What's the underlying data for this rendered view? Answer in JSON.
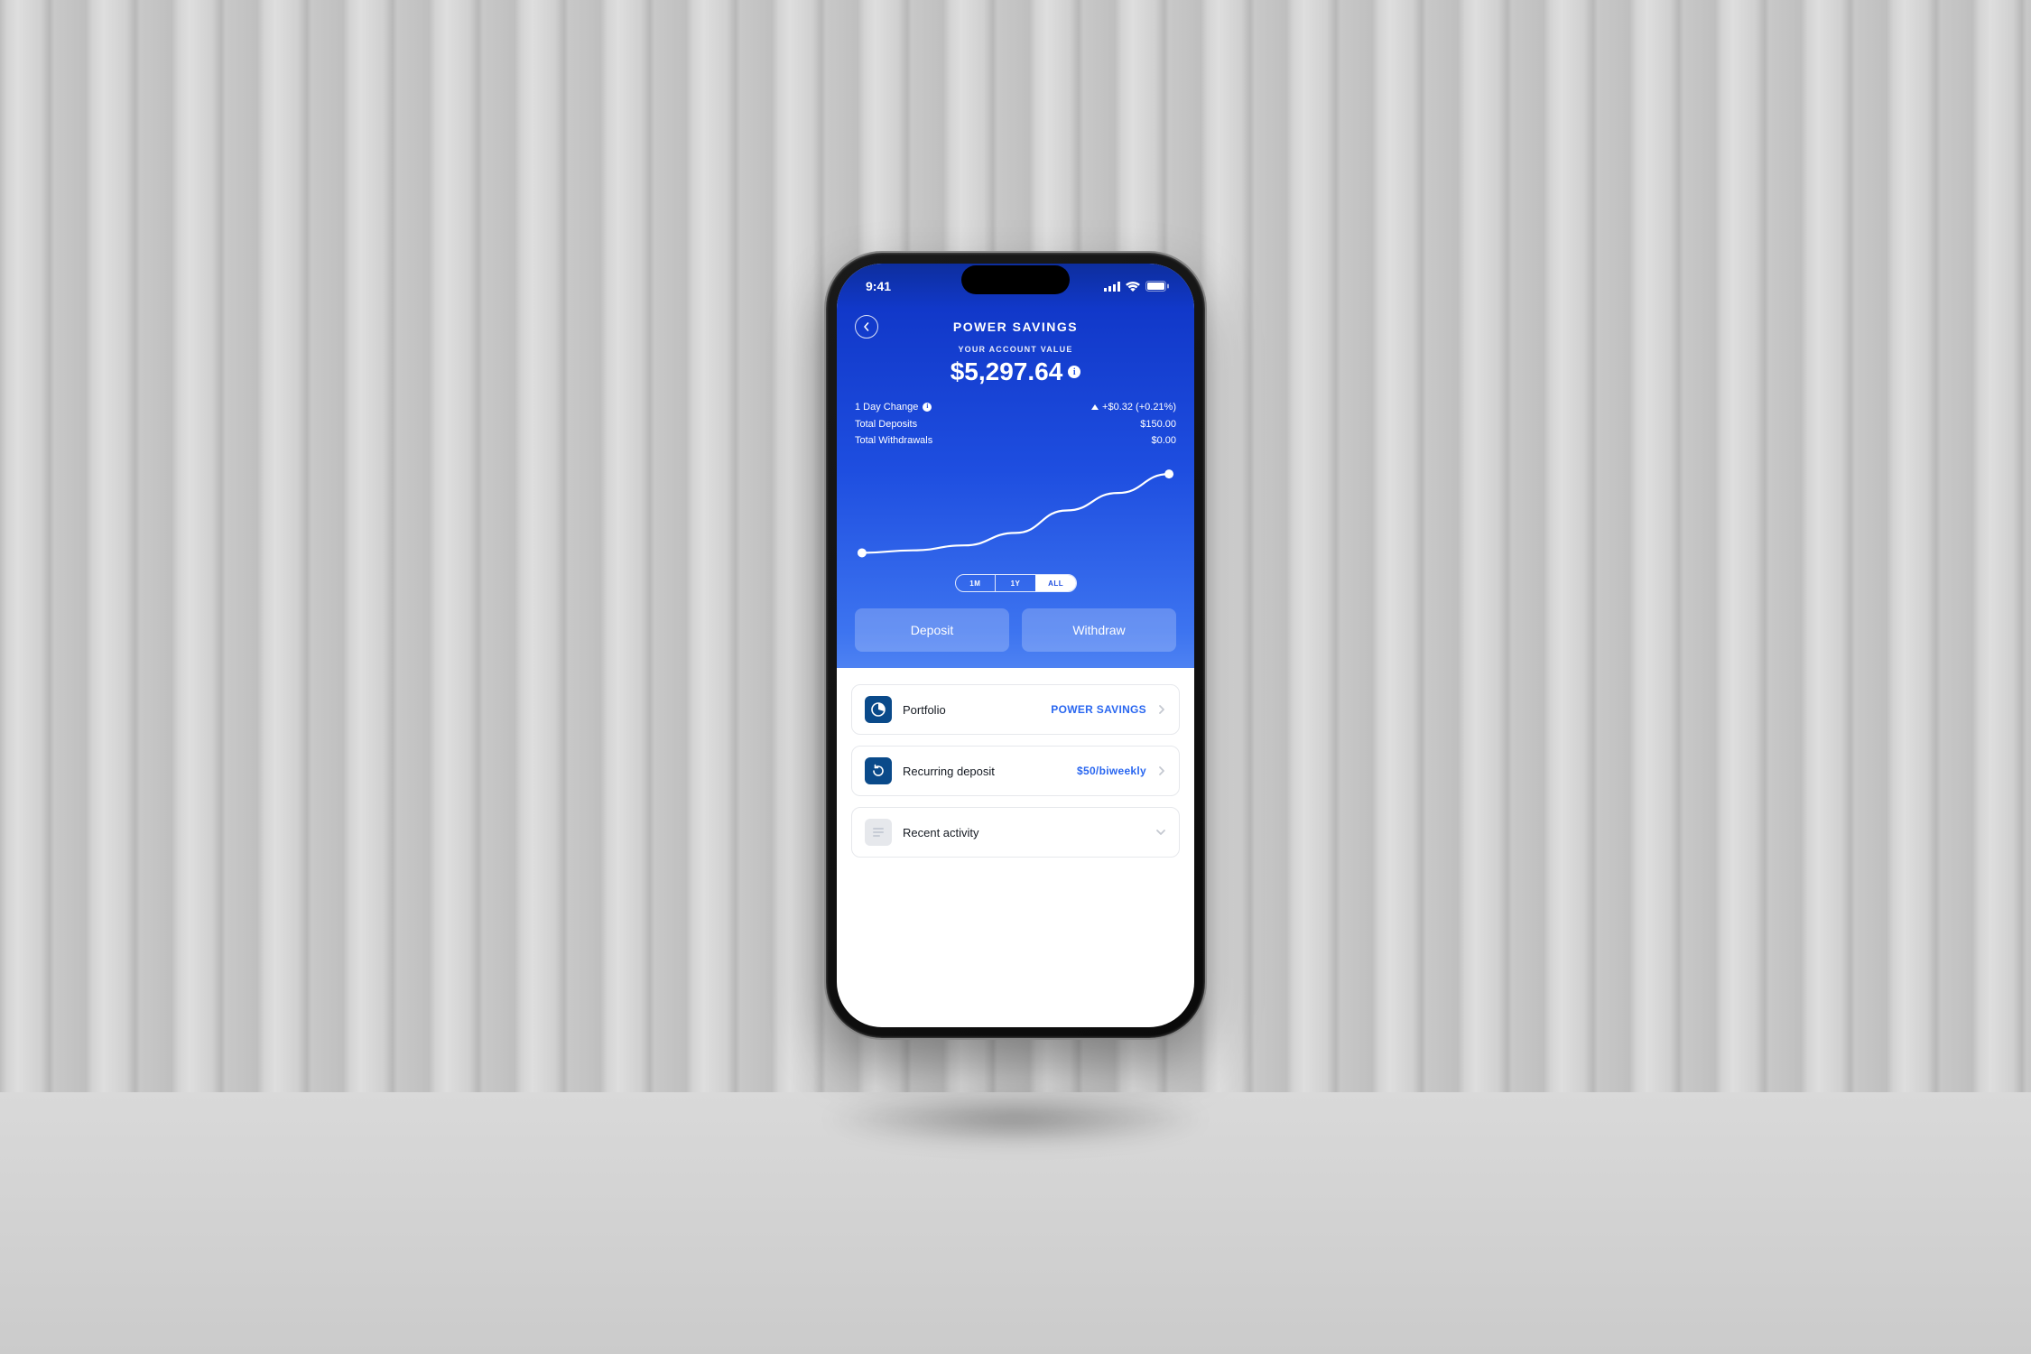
{
  "status": {
    "time": "9:41"
  },
  "header": {
    "title": "POWER SAVINGS",
    "subtitle": "YOUR ACCOUNT VALUE",
    "balance": "$5,297.64"
  },
  "stats": {
    "day_change_label": "1 Day Change",
    "day_change_value": "+$0.32 (+0.21%)",
    "total_deposits_label": "Total Deposits",
    "total_deposits_value": "$150.00",
    "total_withdrawals_label": "Total Withdrawals",
    "total_withdrawals_value": "$0.00"
  },
  "chart_data": {
    "type": "line",
    "title": "Account value over time",
    "x": [
      0,
      1,
      2,
      3,
      4,
      5,
      6
    ],
    "values": [
      5140,
      5145,
      5155,
      5180,
      5225,
      5260,
      5298
    ],
    "ylim": [
      5130,
      5300
    ],
    "xlabel": "",
    "ylabel": ""
  },
  "range": {
    "opt0": "1M",
    "opt1": "1Y",
    "opt2": "ALL",
    "active_index": 2
  },
  "actions": {
    "deposit": "Deposit",
    "withdraw": "Withdraw"
  },
  "cards": {
    "portfolio": {
      "label": "Portfolio",
      "value": "POWER SAVINGS"
    },
    "recurring": {
      "label": "Recurring deposit",
      "value": "$50/biweekly"
    },
    "activity": {
      "label": "Recent activity"
    }
  },
  "colors": {
    "accent": "#2a67f0",
    "hero_top": "#1138c9",
    "hero_bottom": "#4e82f2"
  }
}
